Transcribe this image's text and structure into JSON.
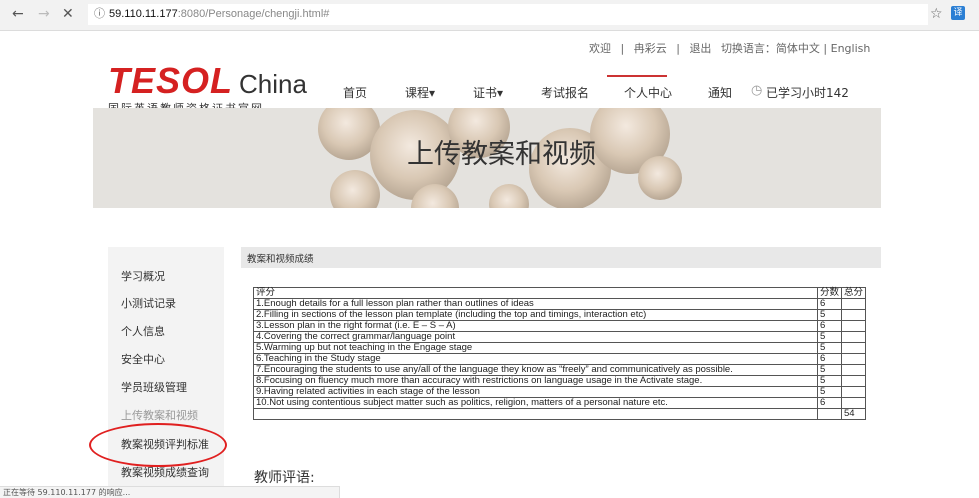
{
  "browser": {
    "back": "←",
    "forward": "→",
    "close": "✕",
    "info_icon": "ⓘ",
    "url_host": "59.110.11.177",
    "url_path": ":8080/Personage/chengji.html#",
    "star": "☆",
    "ext_label": "译",
    "status_text": "正在等待 59.110.11.177 的响应..."
  },
  "top_links": {
    "welcome": "欢迎",
    "sep": "|",
    "user": "冉彩云",
    "logout": "退出",
    "lang_switch": "切换语言：简体中文 | English"
  },
  "logo": {
    "main": "TESOL",
    "china": "China",
    "sub": "国际英语教师资格证书官网"
  },
  "nav": {
    "home": "首页",
    "courses": "课程▾",
    "certificates": "证书▾",
    "exam": "考试报名",
    "personal": "个人中心",
    "notice": "通知",
    "study_hours": "已学习小时142"
  },
  "banner": {
    "title": "上传教案和视频"
  },
  "sidebar": {
    "items": [
      {
        "label": "学习概况"
      },
      {
        "label": "小测试记录"
      },
      {
        "label": "个人信息"
      },
      {
        "label": "安全中心"
      },
      {
        "label": "学员班级管理"
      },
      {
        "label": "上传教案和视频"
      },
      {
        "label": "教案视频评判标准"
      },
      {
        "label": "教案视频成绩查询"
      }
    ]
  },
  "content": {
    "tab": "教案和视频成绩",
    "headers": {
      "criteria": "评分",
      "score": "分数",
      "total": "总分"
    },
    "rows": [
      {
        "text": "1.Enough details for a full lesson plan rather than outlines of ideas",
        "score": "6"
      },
      {
        "text": "2.Filling in sections of the lesson plan template (including the top and timings, interaction etc)",
        "score": "5"
      },
      {
        "text": "3.Lesson plan in the right format (i.e. E – S – A)",
        "score": "6"
      },
      {
        "text": "4.Covering the correct grammar/language point",
        "score": "5"
      },
      {
        "text": "5.Warming up but not teaching in the Engage stage",
        "score": "5"
      },
      {
        "text": "6.Teaching in the Study stage",
        "score": "6"
      },
      {
        "text": "7.Encouraging the students to use any/all of the language they know as “freely” and communicatively as possible.",
        "score": "5"
      },
      {
        "text": "8.Focusing on fluency much more than accuracy with restrictions on language usage in the Activate stage.",
        "score": "5"
      },
      {
        "text": "9.Having related activities in each stage of the lesson",
        "score": "5"
      },
      {
        "text": "10.Not using contentious subject matter such as politics, religion, matters of a personal nature etc.",
        "score": "6"
      }
    ],
    "total": "54",
    "teacher_comment_label": "教师评语:"
  },
  "colors": {
    "brand_red": "#d52121",
    "annotation_red": "#e02020",
    "active_nav": "#c33"
  }
}
